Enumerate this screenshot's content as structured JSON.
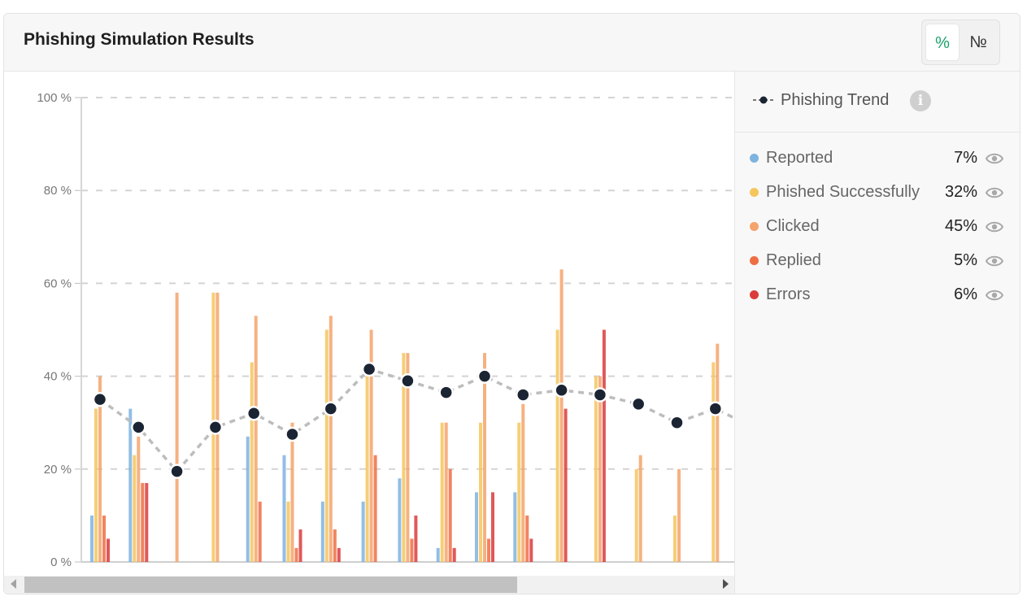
{
  "header": {
    "title": "Phishing Simulation Results",
    "toggle_pct": "%",
    "toggle_num": "№"
  },
  "legend": {
    "trend_label": "Phishing Trend",
    "info_icon": "info-icon",
    "items": [
      {
        "label": "Reported",
        "value": "7%",
        "color": "#7fb3e0"
      },
      {
        "label": "Phished Successfully",
        "value": "32%",
        "color": "#f5c65e"
      },
      {
        "label": "Clicked",
        "value": "45%",
        "color": "#f4a36b"
      },
      {
        "label": "Replied",
        "value": "5%",
        "color": "#ee6f44"
      },
      {
        "label": "Errors",
        "value": "6%",
        "color": "#dc3b3b"
      }
    ]
  },
  "chart_data": {
    "type": "bar",
    "ylim": [
      0,
      100
    ],
    "yticks": [
      "0 %",
      "20 %",
      "40 %",
      "60 %",
      "80 %",
      "100 %"
    ],
    "grid": true,
    "legend_position": "right",
    "colors": {
      "Reported": "#7fb3e0",
      "Phished Successfully": "#f5c65e",
      "Clicked": "#f4a36b",
      "Replied": "#ee6f44",
      "Errors": "#dc3b3b",
      "Phishing Trend": "#1b2432"
    },
    "groups": [
      {
        "bars": [
          [
            "Reported",
            10
          ],
          [
            "Phished Successfully",
            33
          ],
          [
            "Clicked",
            40
          ],
          [
            "Replied",
            10
          ],
          [
            "Errors",
            5
          ]
        ],
        "trend": 35
      },
      {
        "bars": [
          [
            "Reported",
            33
          ],
          [
            "Phished Successfully",
            23
          ],
          [
            "Clicked",
            27
          ],
          [
            "Replied",
            17
          ],
          [
            "Errors",
            17
          ]
        ],
        "trend": 29
      },
      {
        "bars": [
          [
            "Clicked",
            58
          ]
        ],
        "trend": 19.5
      },
      {
        "bars": [
          [
            "Phished Successfully",
            58
          ],
          [
            "Clicked",
            58
          ]
        ],
        "trend": 29
      },
      {
        "bars": [
          [
            "Reported",
            27
          ],
          [
            "Phished Successfully",
            43
          ],
          [
            "Clicked",
            53
          ],
          [
            "Replied",
            13
          ]
        ],
        "trend": 32
      },
      {
        "bars": [
          [
            "Reported",
            23
          ],
          [
            "Phished Successfully",
            13
          ],
          [
            "Clicked",
            30
          ],
          [
            "Replied",
            3
          ],
          [
            "Errors",
            7
          ]
        ],
        "trend": 27.5
      },
      {
        "bars": [
          [
            "Reported",
            13
          ],
          [
            "Phished Successfully",
            50
          ],
          [
            "Clicked",
            53
          ],
          [
            "Replied",
            7
          ],
          [
            "Errors",
            3
          ]
        ],
        "trend": 33
      },
      {
        "bars": [
          [
            "Reported",
            13
          ],
          [
            "Phished Successfully",
            40
          ],
          [
            "Clicked",
            50
          ],
          [
            "Replied",
            23
          ]
        ],
        "trend": 41.5
      },
      {
        "bars": [
          [
            "Reported",
            18
          ],
          [
            "Phished Successfully",
            45
          ],
          [
            "Clicked",
            45
          ],
          [
            "Replied",
            5
          ],
          [
            "Errors",
            10
          ]
        ],
        "trend": 39
      },
      {
        "bars": [
          [
            "Reported",
            3
          ],
          [
            "Phished Successfully",
            30
          ],
          [
            "Clicked",
            30
          ],
          [
            "Replied",
            20
          ],
          [
            "Errors",
            3
          ]
        ],
        "trend": 36.5
      },
      {
        "bars": [
          [
            "Reported",
            15
          ],
          [
            "Phished Successfully",
            30
          ],
          [
            "Clicked",
            45
          ],
          [
            "Replied",
            5
          ],
          [
            "Errors",
            15
          ]
        ],
        "trend": 40
      },
      {
        "bars": [
          [
            "Reported",
            15
          ],
          [
            "Phished Successfully",
            30
          ],
          [
            "Clicked",
            34
          ],
          [
            "Replied",
            10
          ],
          [
            "Errors",
            5
          ]
        ],
        "trend": 36
      },
      {
        "bars": [
          [
            "Phished Successfully",
            50
          ],
          [
            "Clicked",
            63
          ],
          [
            "Errors",
            33
          ]
        ],
        "trend": 37
      },
      {
        "bars": [
          [
            "Phished Successfully",
            40
          ],
          [
            "Clicked",
            40
          ],
          [
            "Errors",
            50
          ]
        ],
        "trend": 36
      },
      {
        "bars": [
          [
            "Phished Successfully",
            20
          ],
          [
            "Clicked",
            23
          ]
        ],
        "trend": 34
      },
      {
        "bars": [
          [
            "Phished Successfully",
            10
          ],
          [
            "Clicked",
            20
          ]
        ],
        "trend": 30
      },
      {
        "bars": [
          [
            "Phished Successfully",
            43
          ],
          [
            "Clicked",
            47
          ]
        ],
        "trend": 33
      }
    ],
    "trend_continues_to": 31
  },
  "scrollbar": {
    "position": 0
  }
}
